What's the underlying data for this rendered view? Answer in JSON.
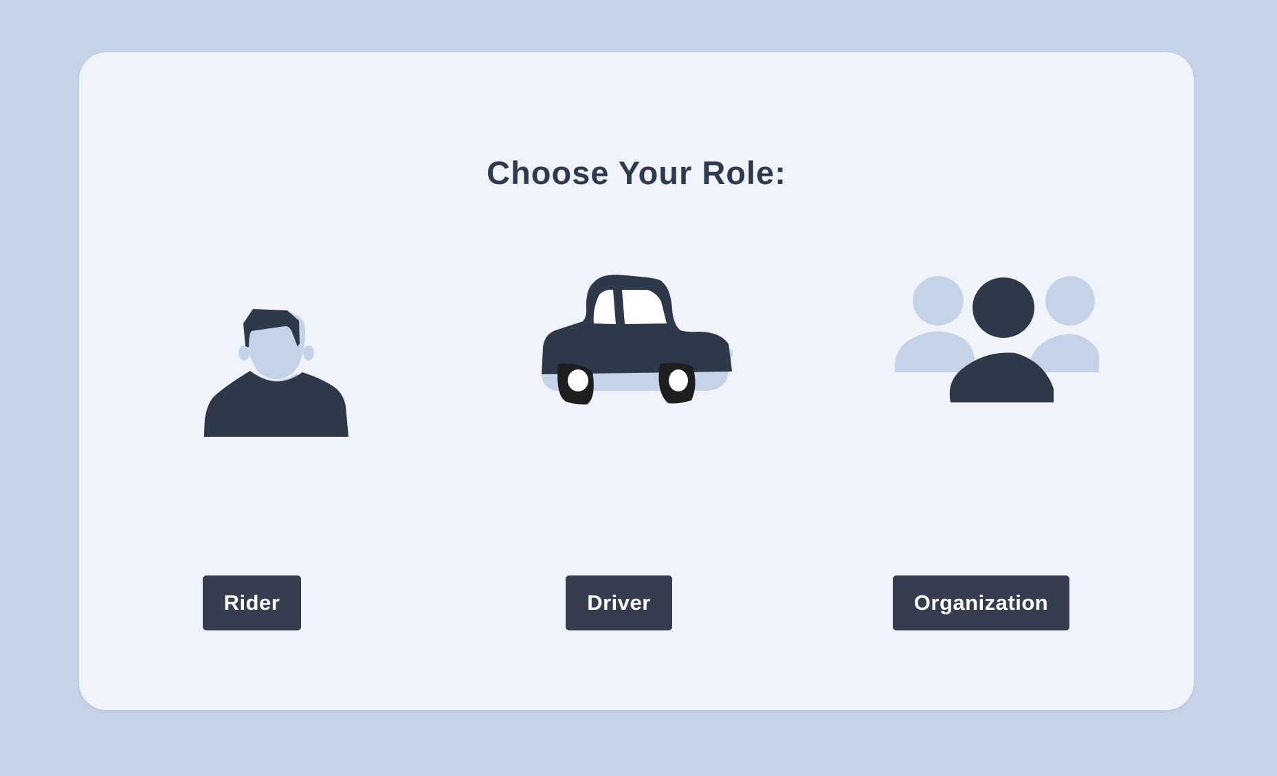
{
  "page": {
    "title": "Choose Your Role:"
  },
  "roles": [
    {
      "id": "rider",
      "label": "Rider",
      "icon": "person-icon"
    },
    {
      "id": "driver",
      "label": "Driver",
      "icon": "car-icon"
    },
    {
      "id": "organization",
      "label": "Organization",
      "icon": "group-icon"
    }
  ],
  "colors": {
    "background": "#c4d3e8",
    "card": "#f0f4fa",
    "title_text": "#2f3a4e",
    "button_background": "#363d4e",
    "button_text": "#ffffff",
    "illustration_dark": "#2d3849",
    "illustration_light": "#c4d3e8"
  }
}
